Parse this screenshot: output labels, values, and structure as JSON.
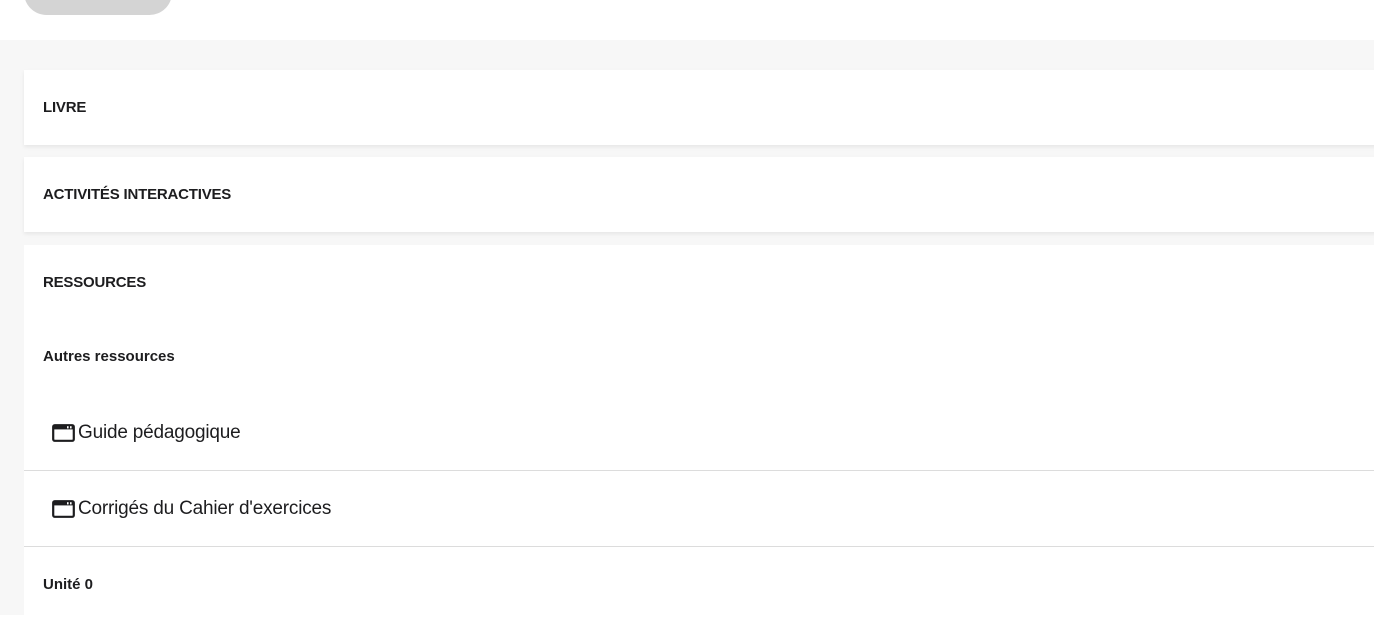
{
  "sections": {
    "livre": "LIVRE",
    "activites": "ACTIVITÉS INTERACTIVES",
    "ressources": "RESSOURCES"
  },
  "ressources": {
    "group_title": "Autres ressources",
    "items": [
      {
        "label": "Guide pédagogique",
        "icon": "window-icon"
      },
      {
        "label": "Corrigés du Cahier d'exercices",
        "icon": "window-icon"
      }
    ],
    "next_group_title": "Unité 0"
  }
}
